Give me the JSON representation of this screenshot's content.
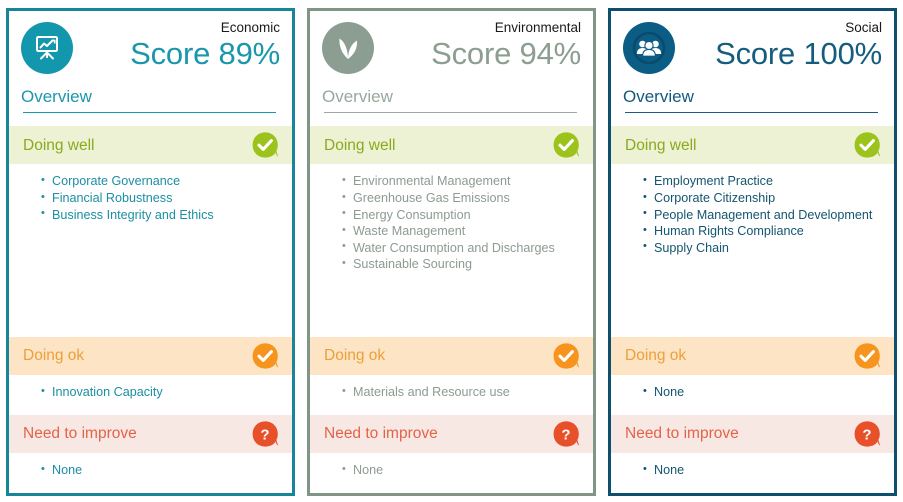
{
  "panels": [
    {
      "id": "economic",
      "category": "Economic",
      "score_text": "Score 89%",
      "score_value": 89,
      "overview_label": "Overview",
      "icon": "presentation-chart-icon",
      "accent": "#1b97ac",
      "border": "#17859a",
      "sections": [
        {
          "key": "doing-well",
          "label": "Doing well",
          "icon": "check-bubble-icon",
          "items": [
            "Corporate Governance",
            "Financial Robustness",
            "Business Integrity and Ethics"
          ]
        },
        {
          "key": "doing-ok",
          "label": "Doing ok",
          "icon": "check-bubble-icon",
          "items": [
            "Innovation Capacity"
          ]
        },
        {
          "key": "need-to-improve",
          "label": "Need to improve",
          "icon": "question-bubble-icon",
          "items": [
            "None"
          ]
        }
      ]
    },
    {
      "id": "environmental",
      "category": "Environmental",
      "score_text": "Score 94%",
      "score_value": 94,
      "overview_label": "Overview",
      "icon": "leaf-sprout-icon",
      "accent": "#8b9e91",
      "border": "#7f9585",
      "sections": [
        {
          "key": "doing-well",
          "label": "Doing well",
          "icon": "check-bubble-icon",
          "items": [
            "Environmental Management",
            "Greenhouse Gas Emissions",
            "Energy Consumption",
            "Waste Management",
            "Water Consumption and Discharges",
            "Sustainable Sourcing"
          ]
        },
        {
          "key": "doing-ok",
          "label": "Doing ok",
          "icon": "check-bubble-icon",
          "items": [
            "Materials and Resource use"
          ]
        },
        {
          "key": "need-to-improve",
          "label": "Need to improve",
          "icon": "question-bubble-icon",
          "items": [
            "None"
          ]
        }
      ]
    },
    {
      "id": "social",
      "category": "Social",
      "score_text": "Score 100%",
      "score_value": 100,
      "overview_label": "Overview",
      "icon": "people-group-icon",
      "accent": "#155d7d",
      "border": "#0f4f6e",
      "sections": [
        {
          "key": "doing-well",
          "label": "Doing well",
          "icon": "check-bubble-icon",
          "items": [
            "Employment Practice",
            "Corporate Citizenship",
            "People Management and Development",
            "Human Rights Compliance",
            "Supply Chain"
          ]
        },
        {
          "key": "doing-ok",
          "label": "Doing ok",
          "icon": "check-bubble-icon",
          "items": [
            "None"
          ]
        },
        {
          "key": "need-to-improve",
          "label": "Need to improve",
          "icon": "question-bubble-icon",
          "items": [
            "None"
          ]
        }
      ]
    }
  ],
  "status_colors": {
    "doing_well_bg": "#eef2d4",
    "doing_well_text": "#8aaa1e",
    "doing_well_icon": "#9cc31b",
    "doing_ok_bg": "#fce4c4",
    "doing_ok_text": "#eda03a",
    "doing_ok_icon": "#f7941d",
    "need_improve_bg": "#f8e8e3",
    "need_improve_text": "#e3634a",
    "need_improve_icon": "#e8502a"
  }
}
